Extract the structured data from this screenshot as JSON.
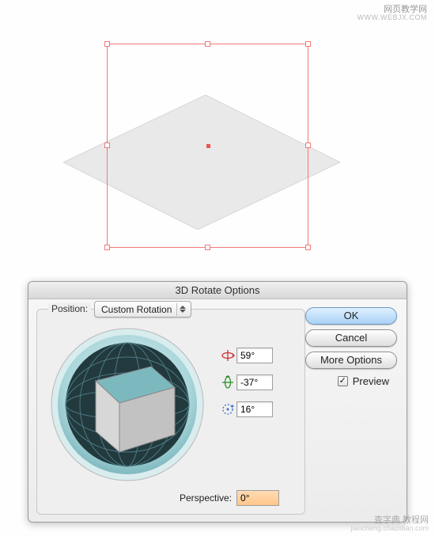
{
  "watermark_top": {
    "line1": "网页教学网",
    "line2": "WWW.WEBJX.COM"
  },
  "watermark_bottom": {
    "line1": "查字典 教程网",
    "line2": "jiaocheng.chazidian.com"
  },
  "dialog": {
    "title": "3D Rotate Options",
    "position_label": "Position:",
    "position_value": "Custom Rotation",
    "angles": {
      "x": "59°",
      "y": "-37°",
      "z": "16°"
    },
    "perspective_label": "Perspective:",
    "perspective_value": "0°",
    "ok": "OK",
    "cancel": "Cancel",
    "more": "More Options",
    "preview_label": "Preview",
    "preview_checked": true
  }
}
